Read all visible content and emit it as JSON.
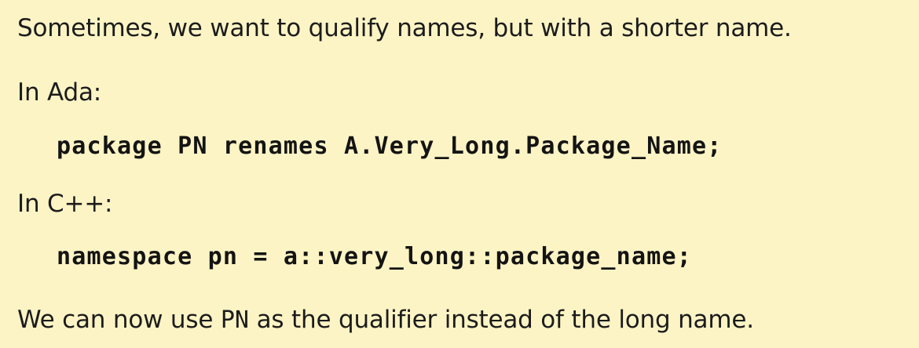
{
  "slide": {
    "intro": "Sometimes, we want to qualify names, but with a shorter name.",
    "ada_label": "In Ada:",
    "ada_code": "package PN renames A.Very_Long.Package_Name;",
    "cpp_label": "In C++:",
    "cpp_code": "namespace pn = a::very_long::package_name;",
    "conclusion": {
      "before": "We can now use ",
      "code": "PN",
      "after": " as the qualifier instead of the long name."
    }
  }
}
